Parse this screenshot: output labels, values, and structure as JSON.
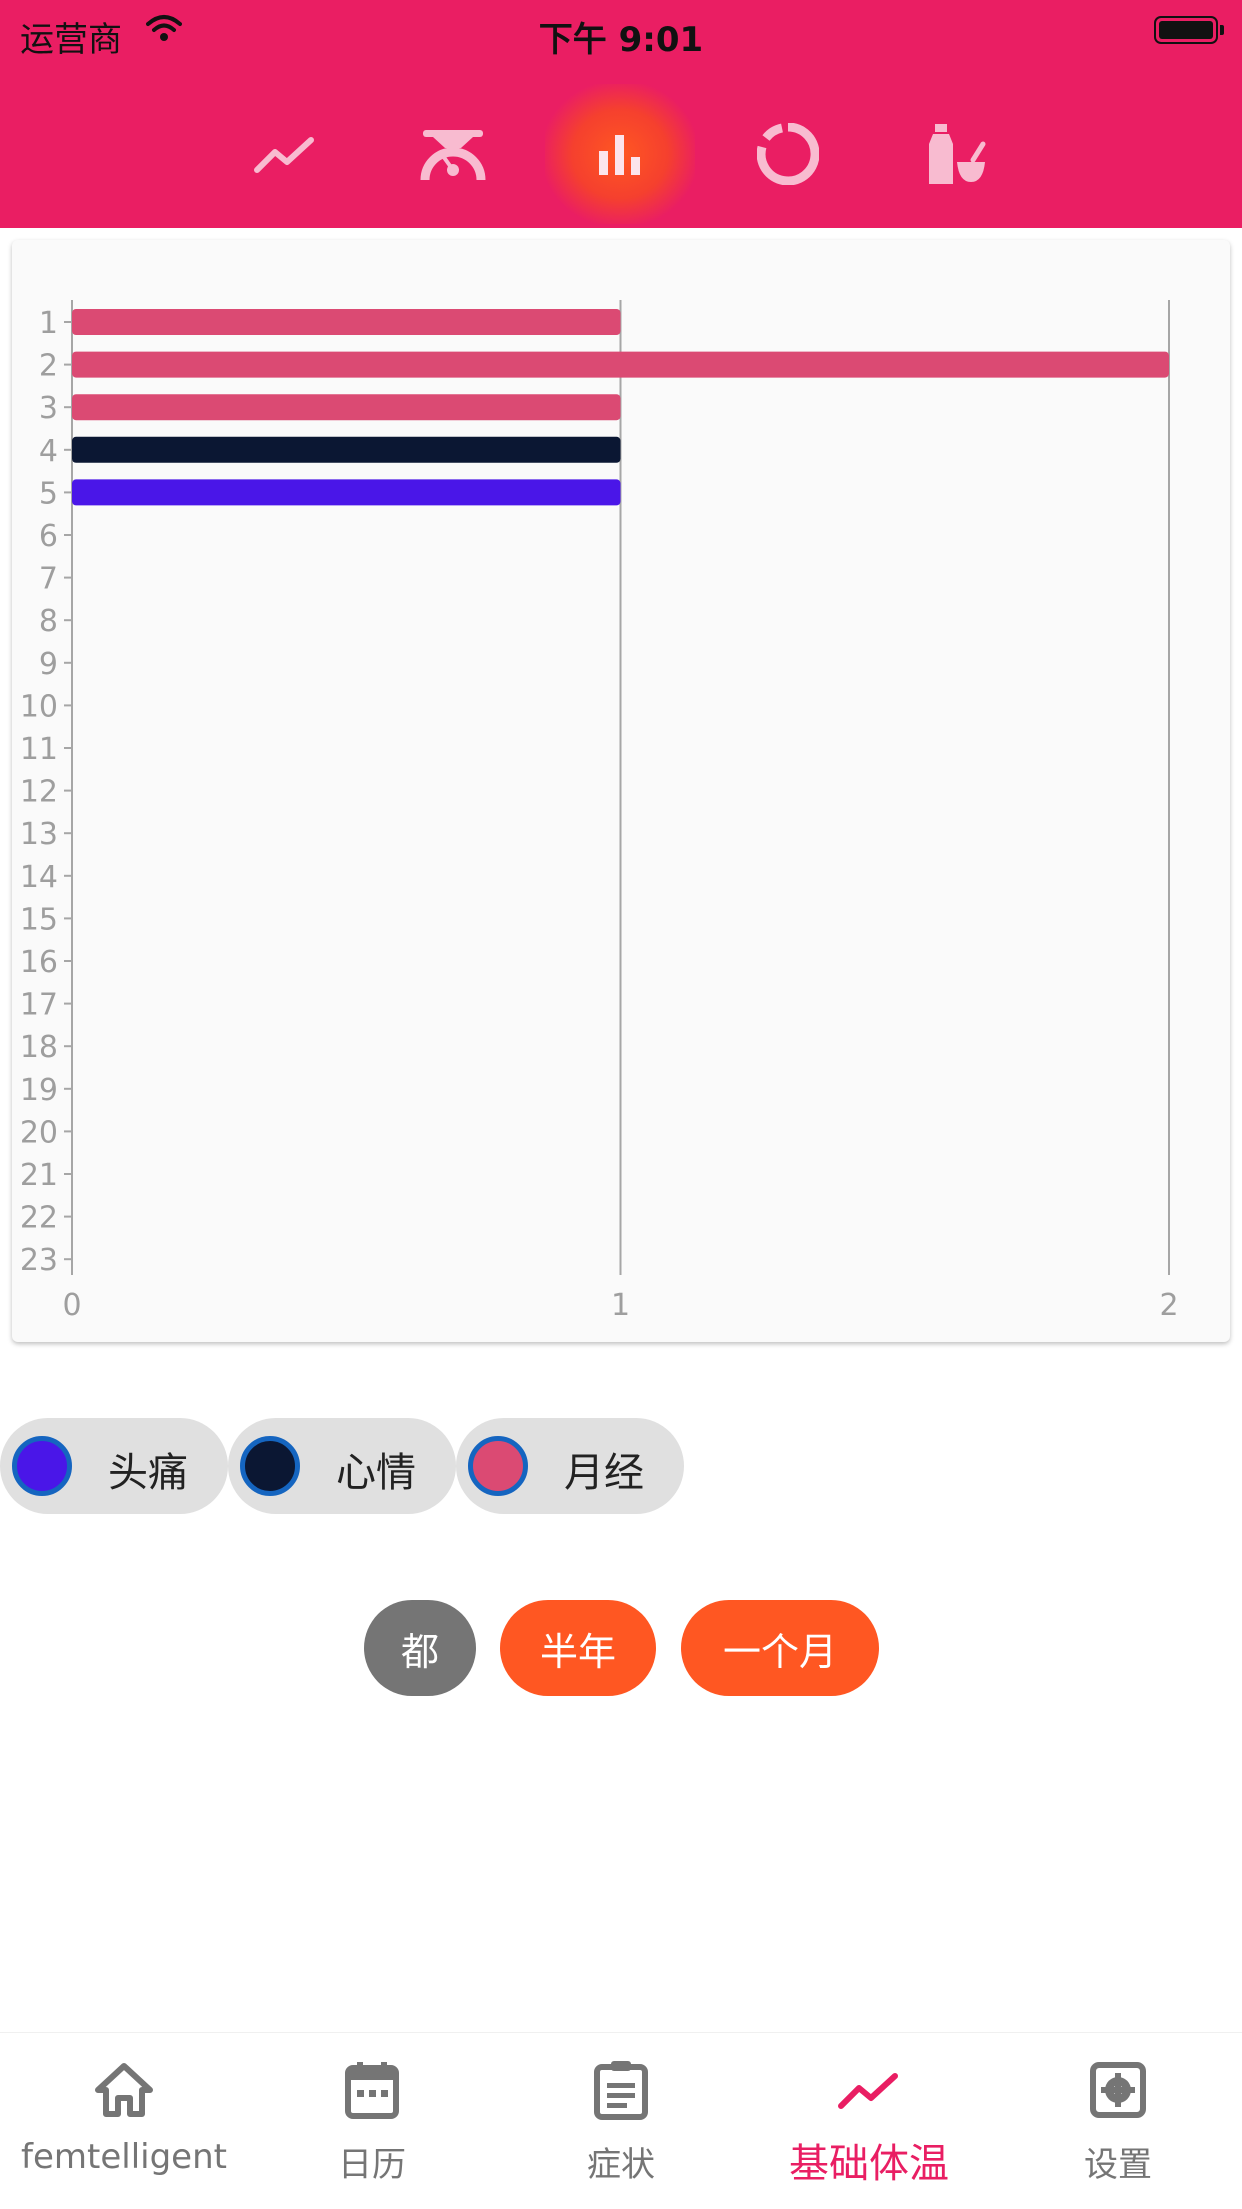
{
  "status_bar": {
    "carrier": "运营商",
    "time": "下午 9:01"
  },
  "chart_tabs": [
    {
      "icon": "line-chart-icon",
      "active": false
    },
    {
      "icon": "gauge-chart-icon",
      "active": false
    },
    {
      "icon": "bar-chart-icon",
      "active": true
    },
    {
      "icon": "donut-chart-icon",
      "active": false
    },
    {
      "icon": "mortar-bottle-icon",
      "active": false
    }
  ],
  "chart_data": {
    "type": "bar",
    "orientation": "horizontal",
    "categories": [
      "1",
      "2",
      "3",
      "4",
      "5",
      "6",
      "7",
      "8",
      "9",
      "10",
      "11",
      "12",
      "13",
      "14",
      "15",
      "16",
      "17",
      "18",
      "19",
      "20",
      "21",
      "22",
      "23"
    ],
    "bars": [
      {
        "category": "1",
        "value": 1,
        "color": "#DB4A73"
      },
      {
        "category": "2",
        "value": 2,
        "color": "#DB4A73"
      },
      {
        "category": "3",
        "value": 1,
        "color": "#DB4A73"
      },
      {
        "category": "4",
        "value": 1,
        "color": "#0B1733"
      },
      {
        "category": "5",
        "value": 1,
        "color": "#4A16E8"
      }
    ],
    "x_ticks": [
      "0",
      "1",
      "2"
    ],
    "xlim": [
      0,
      2
    ],
    "grid": "vertical"
  },
  "legend": [
    {
      "label": "头痛",
      "color": "#4A16E8"
    },
    {
      "label": "心情",
      "color": "#0B1733"
    },
    {
      "label": "月经",
      "color": "#DB4A73"
    }
  ],
  "range_buttons": [
    {
      "label": "都",
      "color": "#757575"
    },
    {
      "label": "半年",
      "color": "#FF5722"
    },
    {
      "label": "一个月",
      "color": "#FF5722"
    }
  ],
  "bottom_nav": [
    {
      "label": "femtelligent",
      "icon": "home-icon",
      "active": false
    },
    {
      "label": "日历",
      "icon": "calendar-icon",
      "active": false
    },
    {
      "label": "症状",
      "icon": "clipboard-icon",
      "active": false
    },
    {
      "label": "基础体温",
      "icon": "trend-icon",
      "active": true
    },
    {
      "label": "设置",
      "icon": "settings-icon",
      "active": false
    }
  ],
  "colors": {
    "header": "#EA1E63",
    "active_tab_glow": "#FF5722",
    "accent": "#E91E63",
    "tab_icon": "#F8BBD0"
  }
}
